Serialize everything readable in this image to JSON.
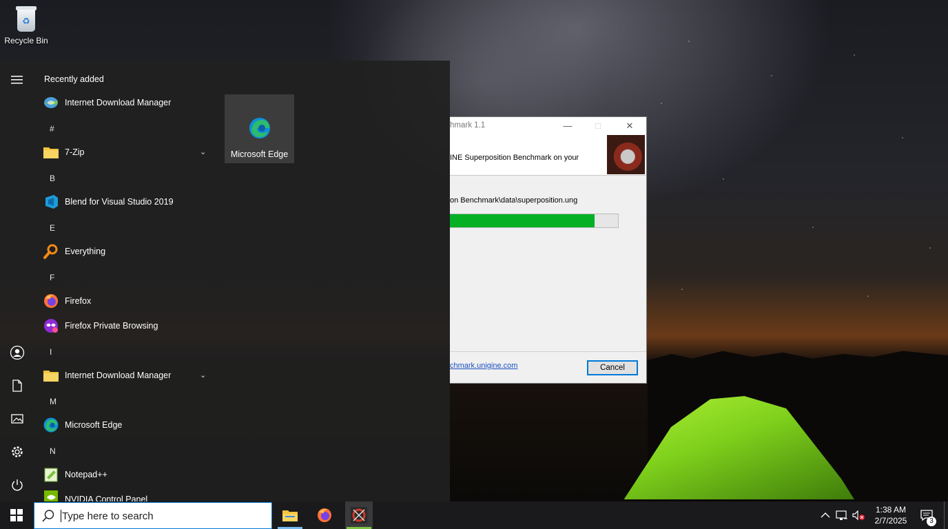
{
  "desktop": {
    "recycle_bin_label": "Recycle Bin"
  },
  "start_menu": {
    "section_title": "Recently added",
    "recent_items": [
      "Internet Download Manager"
    ],
    "letters": [
      "#",
      "B",
      "E",
      "F",
      "I",
      "M",
      "N"
    ],
    "apps": [
      {
        "label": "7-Zip",
        "icon": "folder-icon",
        "expandable": true
      },
      {
        "label": "Blend for Visual Studio 2019",
        "icon": "blend-icon"
      },
      {
        "label": "Everything",
        "icon": "everything-search-icon"
      },
      {
        "label": "Firefox",
        "icon": "firefox-icon"
      },
      {
        "label": "Firefox Private Browsing",
        "icon": "firefox-private-icon"
      },
      {
        "label": "Internet Download Manager",
        "icon": "folder-icon",
        "expandable": true
      },
      {
        "label": "Microsoft Edge",
        "icon": "edge-icon"
      },
      {
        "label": "Notepad++",
        "icon": "notepadpp-icon"
      },
      {
        "label": "NVIDIA Control Panel",
        "icon": "nvidia-icon"
      }
    ],
    "tile": {
      "label": "Microsoft Edge",
      "icon": "edge-icon"
    },
    "rail_icons": [
      "hamburger-menu-icon",
      "user-account-icon",
      "documents-icon",
      "pictures-icon",
      "settings-icon",
      "power-icon"
    ]
  },
  "installer": {
    "title": "hmark 1.1",
    "header_text": "INE Superposition Benchmark on your",
    "path_text": "on Benchmark\\data\\superposition.ung",
    "progress_percent": 86,
    "link_text": "chmark.unigine.com",
    "cancel_label": "Cancel"
  },
  "taskbar": {
    "search_placeholder": "Type here to search",
    "apps": [
      "file-explorer-icon",
      "firefox-icon",
      "superposition-icon"
    ],
    "clock_time": "1:38 AM",
    "clock_date": "2/7/2025",
    "notification_count": "3"
  },
  "colors": {
    "progress": "#06b025",
    "accent": "#0078d7",
    "start_bg": "#202020",
    "taskbar_bg": "#1a1a1c"
  }
}
